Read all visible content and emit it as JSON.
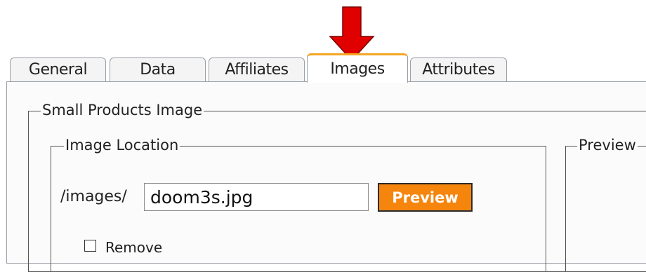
{
  "tabs": [
    {
      "label": "General"
    },
    {
      "label": "Data"
    },
    {
      "label": "Affiliates"
    },
    {
      "label": "Images",
      "active": true
    },
    {
      "label": "Attributes"
    }
  ],
  "small_image": {
    "legend": "Small Products Image",
    "location": {
      "legend": "Image Location",
      "path_prefix": "/images/",
      "filename": "doom3s.jpg",
      "preview_button": "Preview",
      "remove_label": "Remove",
      "remove_checked": false
    },
    "preview_panel": {
      "legend": "Preview"
    }
  },
  "colors": {
    "active_tab_accent": "#f5a623",
    "preview_button_bg": "#f5850d",
    "arrow": "#e00000"
  },
  "icons": {
    "annotation": "down-arrow-icon"
  }
}
